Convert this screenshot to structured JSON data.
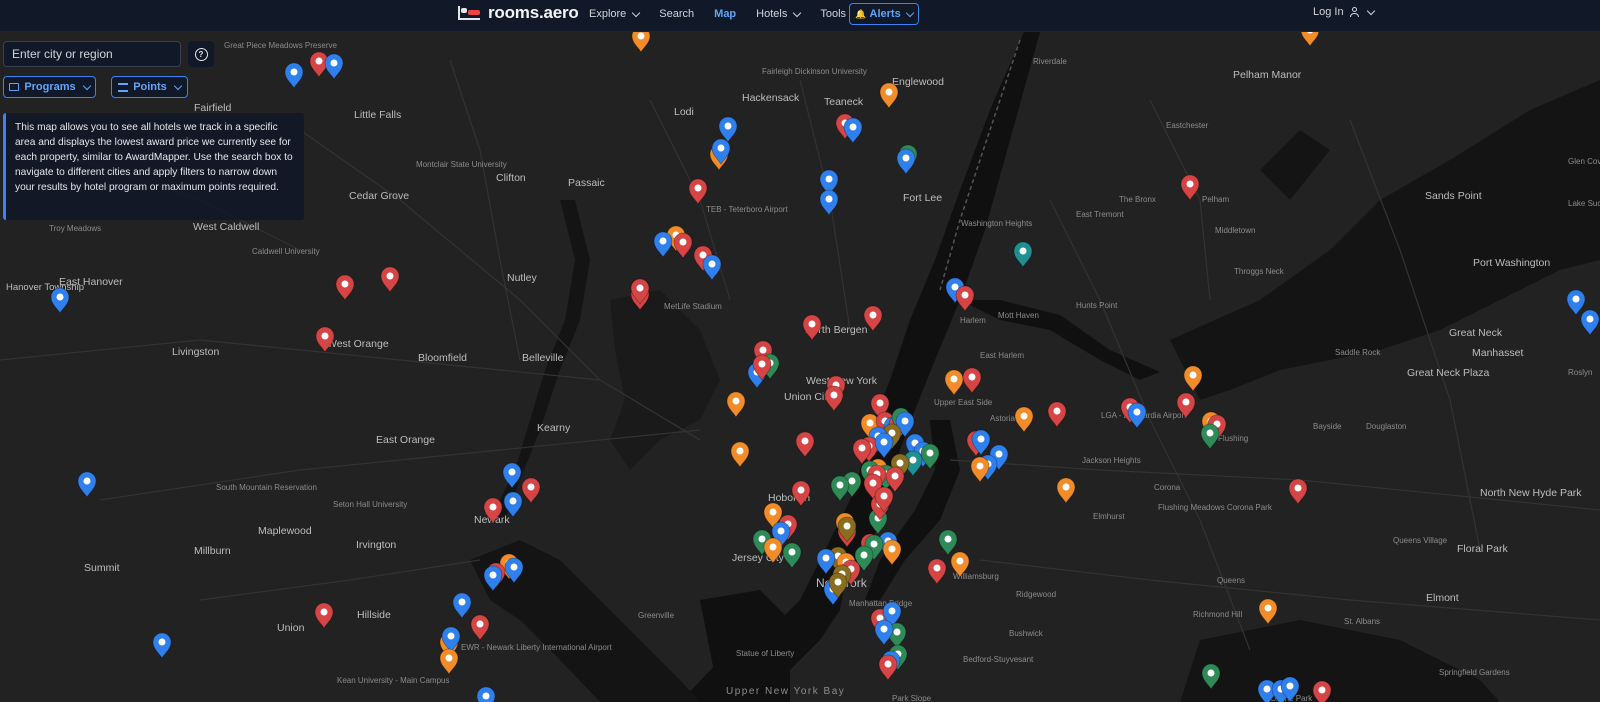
{
  "header": {
    "brand": "rooms.aero",
    "nav": [
      {
        "label": "Explore",
        "dropdown": true,
        "active": false
      },
      {
        "label": "Search",
        "dropdown": false,
        "active": false
      },
      {
        "label": "Map",
        "dropdown": false,
        "active": true
      },
      {
        "label": "Hotels",
        "dropdown": true,
        "active": false
      },
      {
        "label": "Tools",
        "dropdown": true,
        "active": false
      }
    ],
    "alerts_label": "Alerts",
    "login_label": "Log In"
  },
  "controls": {
    "search_placeholder": "Enter city or region",
    "help_icon": "question-circle-icon",
    "programs_label": "Programs",
    "points_label": "Points"
  },
  "info_text": "This map allows you to see all hotels we track in a specific area and displays the lowest award price we currently see for each property, similar to AwardMapper. Use the search box to navigate to different cities and apply filters to narrow down your results by hotel program or maximum points required.",
  "map": {
    "labels_major": [
      "Hackensack",
      "Teaneck",
      "Englewood",
      "Clifton",
      "Passaic",
      "Fort Lee",
      "Nutley",
      "Bloomfield",
      "Belleville",
      "Livingston",
      "West Orange",
      "East Orange",
      "Kearny",
      "Newark",
      "Irvington",
      "Maplewood",
      "Millburn",
      "Summit",
      "Union",
      "Hillside",
      "Hoboken",
      "Jersey City",
      "New York",
      "Union City",
      "West New York",
      "North Bergen",
      "Little Falls",
      "Cedar Grove",
      "West Caldwell",
      "East Hanover",
      "Hanover Township",
      "Fairfield",
      "Pelham Manor",
      "Sands Point",
      "Port Washington",
      "Great Neck",
      "Manhasset",
      "Great Neck Plaza",
      "North New Hyde Park",
      "Floral Park",
      "Elmont",
      "Lodi"
    ],
    "labels_minor": [
      "TEB - Teterboro Airport",
      "EWR - Newark Liberty International Airport",
      "LGA - LaGuardia Airport",
      "Fairleigh Dickinson University",
      "Montclair State University",
      "Caldwell University",
      "Seton Hall University",
      "South Mountain Reservation",
      "Kean University - Main Campus",
      "MetLife Stadium",
      "Statue of Liberty",
      "Manhattan Bridge",
      "Upper New York Bay",
      "Riverdale",
      "Eastchester",
      "The Bronx",
      "Pelham",
      "Middletown",
      "Throggs Neck",
      "Hunts Point",
      "Washington Heights",
      "Harlem",
      "East Harlem",
      "Mott Haven",
      "Upper East Side",
      "Astoria",
      "Jackson Heights",
      "Elmhurst",
      "Corona",
      "Flushing",
      "Flushing Meadows Corona Park",
      "Bayside",
      "Douglaston",
      "Queens Village",
      "Queens",
      "Richmond Hill",
      "St. Albans",
      "Ridgewood",
      "Bushwick",
      "Bedford-Stuyvesant",
      "Springfield Gardens",
      "Ozone Park",
      "Park Slope",
      "Williamsburg",
      "Greenville",
      "Glen Cove",
      "Saddle Rock",
      "Roslyn",
      "East Tremont",
      "Lake Success",
      "Great Piece Meadows Preserve",
      "Troy Meadows"
    ],
    "marker_colors": {
      "red": "#d64545",
      "blue": "#2f80ed",
      "orange": "#f28c28",
      "green": "#2e8b57",
      "teal": "#1f8f8f",
      "olive": "#8b6d1f"
    }
  }
}
